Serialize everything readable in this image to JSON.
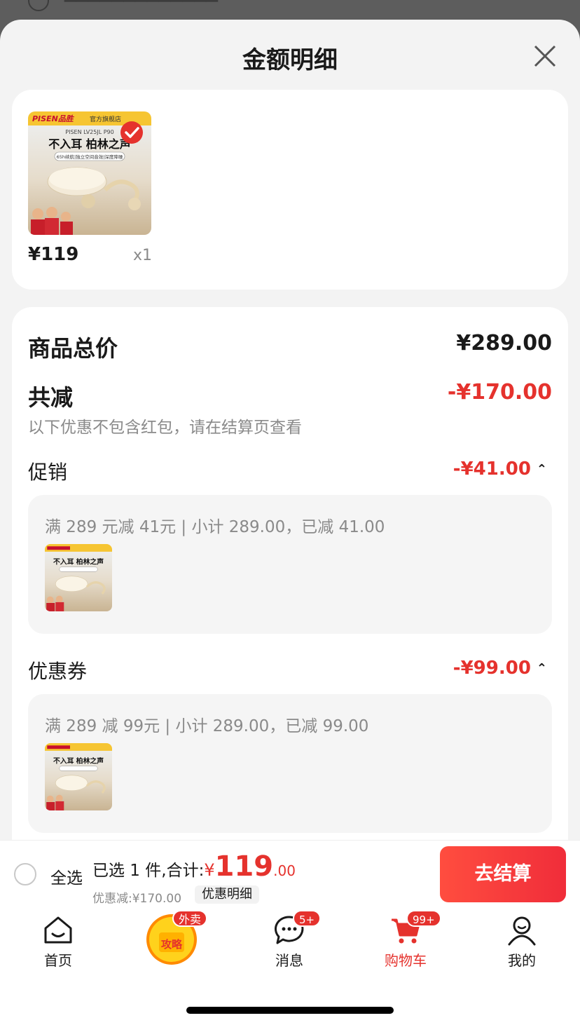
{
  "sheet": {
    "title": "金额明细"
  },
  "product": {
    "brand": "PISEN品胜",
    "store_tag": "官方旗舰店",
    "model": "PISEN LV25JL P90",
    "headline": "不入耳 柏林之声",
    "features": "65h续航|独立空间音效|深度降噪",
    "price": "¥119",
    "qty": "x1"
  },
  "summary": {
    "total_label": "商品总价",
    "total_value": "¥289.00",
    "reduce_label": "共减",
    "reduce_value": "-¥170.00",
    "note": "以下优惠不包含红包，请在结算页查看"
  },
  "promotion": {
    "label": "促销",
    "amount": "-¥41.00",
    "detail": "满 289 元减 41元 | 小计 289.00，已减 41.00"
  },
  "coupon": {
    "label": "优惠券",
    "amount": "-¥99.00",
    "detail": "满 289 减 99元 | 小计 289.00，已减 99.00"
  },
  "bottom": {
    "select_all": "全选",
    "selected_label": "已选 1 件,合计:",
    "currency": "¥",
    "total_int": "119",
    "total_dec": ".00",
    "discount": "优惠减:¥170.00",
    "detail_btn": "优惠明细",
    "checkout": "去结算"
  },
  "tabs": [
    {
      "label": "首页"
    },
    {
      "label": "攻略",
      "badge": "外卖"
    },
    {
      "label": "消息",
      "badge": "5+"
    },
    {
      "label": "购物车",
      "badge": "99+"
    },
    {
      "label": "我的"
    }
  ],
  "colors": {
    "accent": "#e5322d",
    "checkout_start": "#ff4d3f",
    "checkout_end": "#f02d3a"
  }
}
